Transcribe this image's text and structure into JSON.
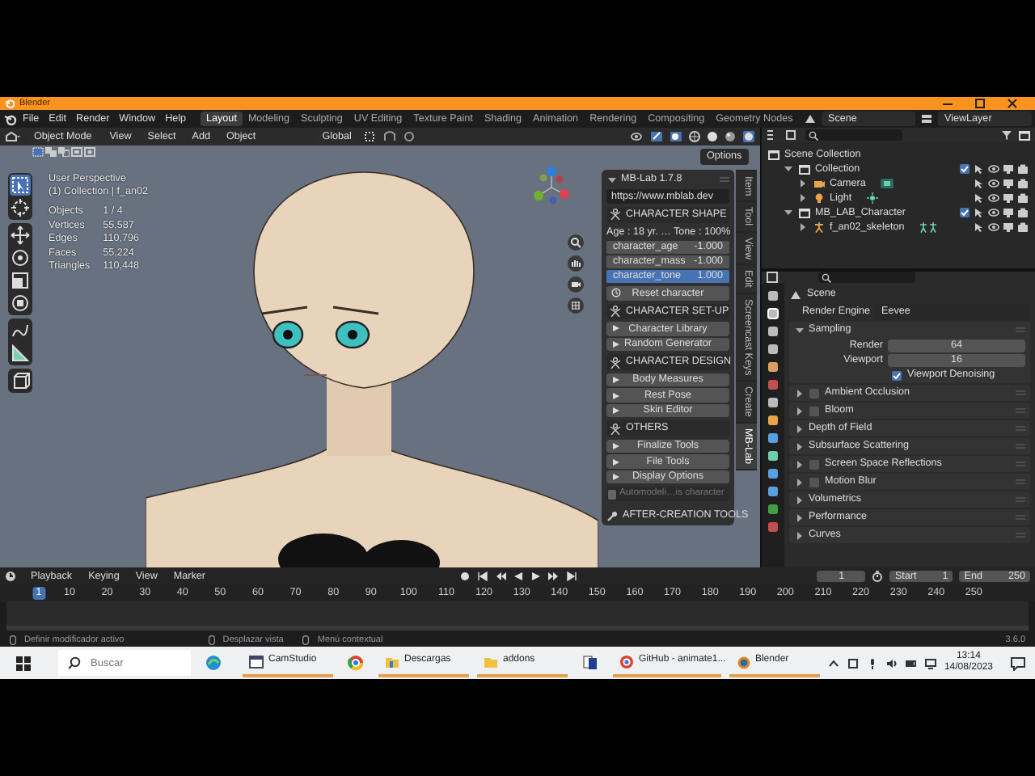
{
  "window": {
    "title": "Blender"
  },
  "menu": [
    "File",
    "Edit",
    "Render",
    "Window",
    "Help"
  ],
  "workspace_tabs": [
    {
      "label": "Layout",
      "selected": true
    },
    {
      "label": "Modeling",
      "selected": false
    },
    {
      "label": "Sculpting",
      "selected": false
    },
    {
      "label": "UV Editing",
      "selected": false
    },
    {
      "label": "Texture Paint",
      "selected": false
    },
    {
      "label": "Shading",
      "selected": false
    },
    {
      "label": "Animation",
      "selected": false
    },
    {
      "label": "Rendering",
      "selected": false
    },
    {
      "label": "Compositing",
      "selected": false
    },
    {
      "label": "Geometry Nodes",
      "selected": false
    }
  ],
  "scene": "Scene",
  "view_layer": "ViewLayer",
  "viewport_header": {
    "mode": "Object Mode",
    "menus": [
      "View",
      "Select",
      "Add",
      "Object"
    ],
    "orientation": "Global",
    "options": "Options"
  },
  "overlay": {
    "view": "User Perspective",
    "collection": "(1) Collection | f_an02",
    "stats": [
      {
        "label": "Objects",
        "value": "1 / 4"
      },
      {
        "label": "Vertices",
        "value": "55,587"
      },
      {
        "label": "Edges",
        "value": "110,796"
      },
      {
        "label": "Faces",
        "value": "55,224"
      },
      {
        "label": "Triangles",
        "value": "110,448"
      }
    ]
  },
  "mblab": {
    "title": "MB-Lab 1.7.8",
    "url": "https://www.mblab.dev",
    "sections": [
      {
        "title": "CHARACTER SHAPE",
        "summary": "Age : 18 yr. … Tone : 100%",
        "sliders": [
          {
            "label": "character_age",
            "value": "-1.000",
            "level": 0
          },
          {
            "label": "character_mass",
            "value": "-1.000",
            "level": 0
          },
          {
            "label": "character_tone",
            "value": "1.000",
            "level": 1
          }
        ],
        "buttons": [
          {
            "label": "Reset character",
            "kind": "action"
          }
        ]
      },
      {
        "title": "CHARACTER SET-UP",
        "buttons": [
          {
            "label": "Character Library",
            "kind": "expander"
          },
          {
            "label": "Random Generator",
            "kind": "expander"
          }
        ]
      },
      {
        "title": "CHARACTER DESIGN",
        "buttons": [
          {
            "label": "Body Measures",
            "kind": "expander"
          },
          {
            "label": "Rest Pose",
            "kind": "expander"
          },
          {
            "label": "Skin Editor",
            "kind": "expander"
          }
        ]
      },
      {
        "title": "OTHERS",
        "buttons": [
          {
            "label": "Finalize Tools",
            "kind": "expander"
          },
          {
            "label": "File Tools",
            "kind": "expander"
          },
          {
            "label": "Display Options",
            "kind": "expander"
          }
        ]
      }
    ],
    "automodelling": {
      "label": "Automodeli…is character",
      "disabled": true
    },
    "after_tools": "AFTER-CREATION TOOLS"
  },
  "side_tabs": [
    {
      "label": "Item",
      "selected": false
    },
    {
      "label": "Tool",
      "selected": false
    },
    {
      "label": "View",
      "selected": false
    },
    {
      "label": "Edit",
      "selected": false
    },
    {
      "label": "Screencast Keys",
      "selected": false
    },
    {
      "label": "Create",
      "selected": false
    },
    {
      "label": "MB-Lab",
      "selected": true
    }
  ],
  "outliner": [
    {
      "label": "Scene Collection",
      "kind": "root",
      "children": [
        {
          "label": "Collection",
          "kind": "collection",
          "checked": true,
          "expanded": true,
          "children": [
            {
              "label": "Camera",
              "kind": "camera",
              "expanded": false
            },
            {
              "label": "Light",
              "kind": "light",
              "expanded": false
            }
          ]
        },
        {
          "label": "MB_LAB_Character",
          "kind": "collection",
          "checked": true,
          "expanded": true,
          "children": [
            {
              "label": "f_an02_skeleton",
              "kind": "armature",
              "expanded": false
            }
          ]
        }
      ]
    }
  ],
  "properties": {
    "context": "Scene",
    "render_engine": {
      "label": "Render Engine",
      "value": "Eevee"
    },
    "panels": [
      {
        "label": "Sampling",
        "kind": "plain",
        "expanded": true,
        "fields": [
          {
            "label": "Render",
            "value": "64"
          },
          {
            "label": "Viewport",
            "value": "16"
          }
        ],
        "checkbox": {
          "label": "Viewport Denoising",
          "checked": true
        }
      },
      {
        "label": "Ambient Occlusion",
        "kind": "toggle",
        "expanded": false,
        "checked": false
      },
      {
        "label": "Bloom",
        "kind": "toggle",
        "expanded": false,
        "checked": false
      },
      {
        "label": "Depth of Field",
        "kind": "plain",
        "expanded": false
      },
      {
        "label": "Subsurface Scattering",
        "kind": "plain",
        "expanded": false
      },
      {
        "label": "Screen Space Reflections",
        "kind": "toggle",
        "expanded": false,
        "checked": false
      },
      {
        "label": "Motion Blur",
        "kind": "toggle",
        "expanded": false,
        "checked": false
      },
      {
        "label": "Volumetrics",
        "kind": "plain",
        "expanded": false
      },
      {
        "label": "Performance",
        "kind": "plain",
        "expanded": false
      },
      {
        "label": "Curves",
        "kind": "plain",
        "expanded": false
      }
    ]
  },
  "timeline": {
    "menus": [
      "Playback",
      "Keying",
      "View",
      "Marker"
    ],
    "current_frame": "1",
    "start": {
      "label": "Start",
      "value": "1"
    },
    "end": {
      "label": "End",
      "value": "250"
    },
    "ruler": [
      {
        "label": "1",
        "selected": true
      },
      {
        "label": "10",
        "selected": false
      },
      {
        "label": "20",
        "selected": false
      },
      {
        "label": "30",
        "selected": false
      },
      {
        "label": "40",
        "selected": false
      },
      {
        "label": "50",
        "selected": false
      },
      {
        "label": "60",
        "selected": false
      },
      {
        "label": "70",
        "selected": false
      },
      {
        "label": "80",
        "selected": false
      },
      {
        "label": "90",
        "selected": false
      },
      {
        "label": "100",
        "selected": false
      },
      {
        "label": "110",
        "selected": false
      },
      {
        "label": "120",
        "selected": false
      },
      {
        "label": "130",
        "selected": false
      },
      {
        "label": "140",
        "selected": false
      },
      {
        "label": "150",
        "selected": false
      },
      {
        "label": "160",
        "selected": false
      },
      {
        "label": "170",
        "selected": false
      },
      {
        "label": "180",
        "selected": false
      },
      {
        "label": "190",
        "selected": false
      },
      {
        "label": "200",
        "selected": false
      },
      {
        "label": "210",
        "selected": false
      },
      {
        "label": "220",
        "selected": false
      },
      {
        "label": "230",
        "selected": false
      },
      {
        "label": "240",
        "selected": false
      },
      {
        "label": "250",
        "selected": false
      }
    ]
  },
  "status_bar": {
    "hints": [
      "Definir modificador activo",
      "Desplazar vista",
      "Menú contextual"
    ],
    "version": "3.6.0"
  },
  "taskbar": {
    "search": {
      "placeholder": "Buscar"
    },
    "apps": [
      {
        "label": "CamStudio",
        "running": true
      },
      {
        "label": "Descargas",
        "running": true
      },
      {
        "label": "addons",
        "running": true
      },
      {
        "label": "GitHub - animate1...",
        "running": true
      },
      {
        "label": "Blender",
        "running": true
      }
    ],
    "time": "13:14",
    "date": "14/08/2023"
  }
}
